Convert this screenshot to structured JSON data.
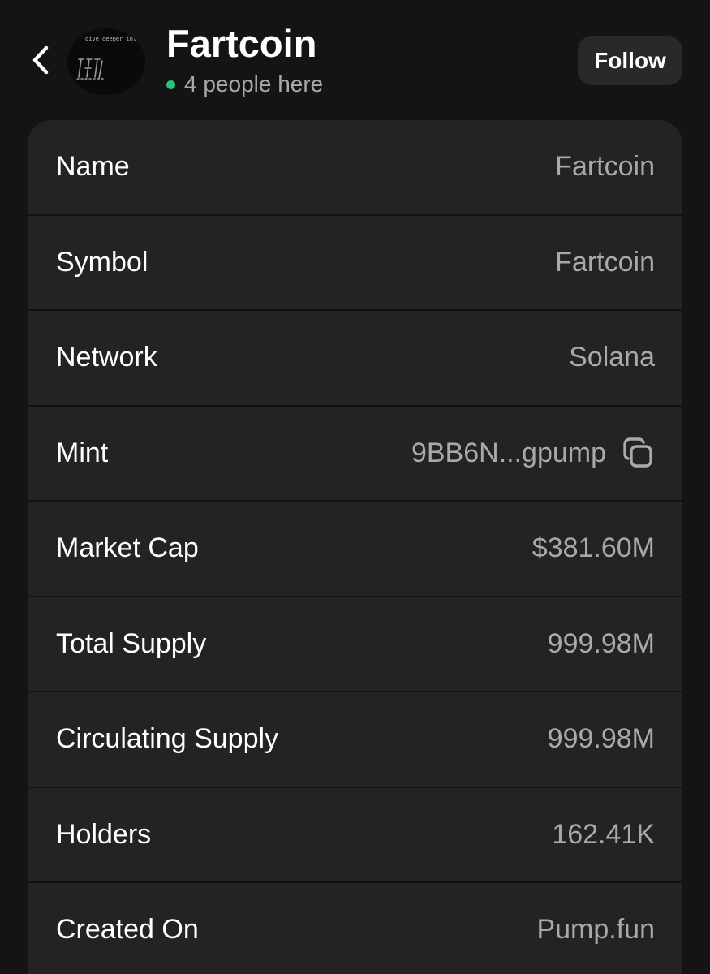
{
  "header": {
    "back_icon": "chevron-left-icon",
    "avatar_caption": "dive deeper into this",
    "title": "Fartcoin",
    "presence": {
      "status_color": "#2bc37c",
      "text": "4 people here"
    },
    "follow_label": "Follow"
  },
  "details": {
    "rows": [
      {
        "label": "Name",
        "value": "Fartcoin"
      },
      {
        "label": "Symbol",
        "value": "Fartcoin"
      },
      {
        "label": "Network",
        "value": "Solana"
      },
      {
        "label": "Mint",
        "value": "9BB6N...gpump",
        "action_icon": "copy-icon"
      },
      {
        "label": "Market Cap",
        "value": "$381.60M"
      },
      {
        "label": "Total Supply",
        "value": "999.98M"
      },
      {
        "label": "Circulating Supply",
        "value": "999.98M"
      },
      {
        "label": "Holders",
        "value": "162.41K"
      },
      {
        "label": "Created On",
        "value": "Pump.fun"
      }
    ]
  },
  "colors": {
    "background": "#141414",
    "card": "#232323",
    "label": "#ffffff",
    "value": "#a9a9a9",
    "button": "#292929"
  }
}
